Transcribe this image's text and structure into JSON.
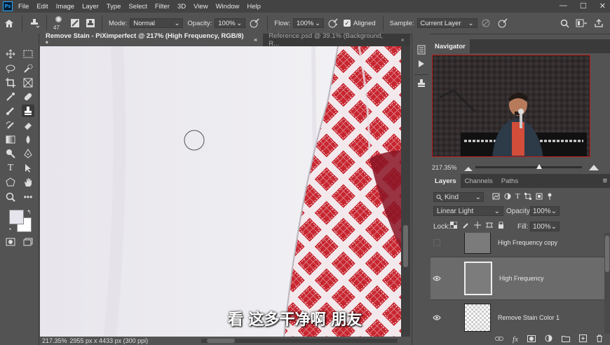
{
  "app": {
    "logo": "Ps"
  },
  "menu": [
    "File",
    "Edit",
    "Image",
    "Layer",
    "Type",
    "Select",
    "Filter",
    "3D",
    "View",
    "Window",
    "Help"
  ],
  "window_controls": {
    "minimize": "—",
    "maximize": "☐",
    "close": "✕"
  },
  "options": {
    "brush_size": "47",
    "mode_label": "Mode:",
    "mode_value": "Normal",
    "opacity_label": "Opacity:",
    "opacity_value": "100%",
    "flow_label": "Flow:",
    "flow_value": "100%",
    "aligned_label": "Aligned",
    "aligned_checked": true,
    "sample_label": "Sample:",
    "sample_value": "Current Layer"
  },
  "tabs": [
    {
      "label": "Remove Stain - PiXimperfect @ 217% (High Frequency, RGB/8) *",
      "close": "×"
    },
    {
      "label": "Reference.psd @ 39.1% (Background, R...",
      "close": "×"
    }
  ],
  "canvas": {
    "subtitle": "看 这多干净啊 朋友"
  },
  "status": {
    "zoom": "217.35%",
    "doc_info": "2955 px x 4433 px (300 ppi)"
  },
  "navigator": {
    "title": "Navigator",
    "zoom": "217.35%",
    "zoom_slider": 0.6
  },
  "layers_panel": {
    "tabs": [
      "Layers",
      "Channels",
      "Paths"
    ],
    "filter_kind": "Kind",
    "blend_mode": "Linear Light",
    "opacity_label": "Opacity:",
    "opacity_value": "100%",
    "lock_label": "Lock:",
    "fill_label": "Fill:",
    "fill_value": "100%",
    "layers": [
      {
        "name": "High Frequency copy",
        "visible": false
      },
      {
        "name": "High Frequency",
        "visible": true,
        "selected": true
      },
      {
        "name": "Remove Stain Color 1",
        "visible": true
      }
    ]
  },
  "colors": {
    "accent": "#31a8ff",
    "panel_bg": "#535353",
    "dark_bg": "#3a3a3a",
    "fabric_red": "#c8252f"
  }
}
